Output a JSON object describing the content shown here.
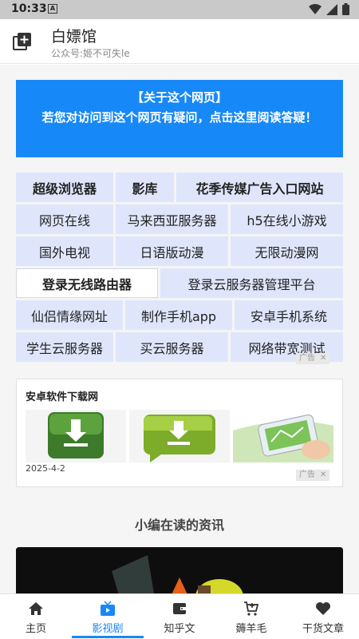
{
  "status_bar": {
    "time": "10:33",
    "notif_letter": "A"
  },
  "app_bar": {
    "title": "白嫖馆",
    "subtitle": "公众号:姬不可失le"
  },
  "notice": {
    "line1": "【关于这个网页】",
    "line2": "若您对访问到这个网页有疑问，点击这里阅读答疑！"
  },
  "link_grid": {
    "rows": [
      [
        "超级浏览器",
        "影库",
        "花季传媒广告入口网站"
      ],
      [
        "网页在线",
        "马来西亚服务器",
        "h5在线小游戏"
      ],
      [
        "国外电视",
        "日语版动漫",
        "无限动漫网"
      ],
      [
        "登录无线路由器",
        "登录云服务器管理平台"
      ],
      [
        "仙侣情缘网址",
        "制作手机app",
        "安卓手机系统"
      ],
      [
        "学生云服务器",
        "买云服务器",
        "网络带宽测试"
      ]
    ]
  },
  "ad_tag": "广告",
  "ad_card": {
    "title": "安卓软件下载网",
    "date": "2025-4-2"
  },
  "section": {
    "title": "小编在读的资讯"
  },
  "bottom_nav": [
    {
      "label": "主页",
      "icon": "home-icon",
      "active": false
    },
    {
      "label": "影视剧",
      "icon": "tv-icon",
      "active": true
    },
    {
      "label": "知乎文",
      "icon": "wallet-icon",
      "active": false
    },
    {
      "label": "薅羊毛",
      "icon": "cart-icon",
      "active": false
    },
    {
      "label": "干货文章",
      "icon": "heart-icon",
      "active": false
    }
  ],
  "colors": {
    "accent": "#1788f8",
    "cell_bg": "#dfe6fb"
  }
}
